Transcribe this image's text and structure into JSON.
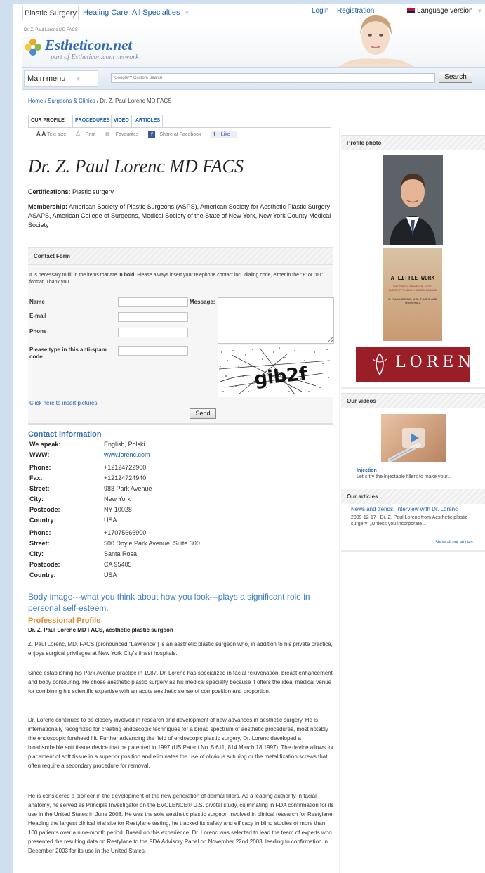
{
  "topnav": {
    "tabs": [
      "Plastic Surgery",
      "Healing Care",
      "All Specialties"
    ],
    "login": "Login",
    "registration": "Registration",
    "language": "Language version"
  },
  "header": {
    "breadcrumb_small": "Dr. Z. Paul Lorenc MD FACS",
    "logo": "Estheticon.net",
    "logo_sub": "part of Estheticon.com network"
  },
  "menubar": {
    "main_menu": "Main menu",
    "search_placeholder": "Google™ Custom Search",
    "search_button": "Search"
  },
  "breadcrumb": {
    "home": "Home",
    "sep": " / ",
    "surgeons": "Surgeons & Clinics",
    "current": "Dr. Z. Paul Lorenc MD FACS"
  },
  "tabs": [
    "OUR PROFILE",
    "PROCEDURES",
    "VIDEO",
    "ARTICLES"
  ],
  "toolbar": {
    "text_size": "Text size",
    "print": "Print",
    "favourites": "Favourites",
    "share": "Share at Facebook",
    "like": "Like"
  },
  "profile": {
    "name": "Dr. Z. Paul Lorenc MD FACS",
    "cert_label": "Certifications:",
    "cert_value": "Plastic surgery",
    "member_label": "Membership:",
    "member_value": "American Society of Plastic Surgeons (ASPS), American Society for Aesthetic Plastic Surgery ASAPS, American College of Surgeons, Medical Society of the State of New York, New York County Medical Society"
  },
  "contact_form": {
    "title": "Contact Form",
    "note_pre": "It is necessary to fill in the items that are ",
    "note_bold": "in bold",
    "note_post": ". Please always insert your telephone contact incl. dialing code, either in the \"+\" or \"00\" format. Thank you.",
    "name": "Name",
    "email": "E-mail",
    "phone": "Phone",
    "antispam": "Please type in this anti-spam code",
    "message": "Message:",
    "insert_pictures": "Click here to insert pictures.",
    "send": "Send"
  },
  "contact_info": {
    "title": "Contact information",
    "rows": [
      {
        "k": "We speak:",
        "v": "English, Polski"
      },
      {
        "k": "WWW:",
        "v": "www.lorenc.com"
      },
      {
        "k": "Phone:",
        "v": "+12124722900"
      },
      {
        "k": "Fax:",
        "v": "+12124724940"
      },
      {
        "k": "Street:",
        "v": "983 Park Avenue"
      },
      {
        "k": "City:",
        "v": "New York"
      },
      {
        "k": "Postcode:",
        "v": "NY 10028"
      },
      {
        "k": "Country:",
        "v": "USA"
      },
      {
        "k": "Phone:",
        "v": "+17075666900"
      },
      {
        "k": "Street:",
        "v": "500 Doyle Park Avenue, Suite 300"
      },
      {
        "k": "City:",
        "v": "Santa Rosa"
      },
      {
        "k": "Postcode:",
        "v": "CA 95405"
      },
      {
        "k": "Country:",
        "v": "USA"
      }
    ]
  },
  "article": {
    "quote": "Body image---what you think about how you look---plays a significant role in personal self-esteem.",
    "pp_title": "Professional Profile",
    "pp_sub": "Dr. Z. Paul Lorenc MD FACS, aesthetic plastic surgeon",
    "paragraphs": [
      "Z. Paul Lorenc, MD, FACS (pronounced \"Lawrence\") is an aesthetic plastic surgeon who, in addition to his private practice, enjoys surgical privileges at New York City's finest hospitals.",
      "Since establishing his Park Avenue practice in 1987, Dr. Lorenc has specialized in facial rejuvenation, breast enhancement and body contouring. He chose aesthetic plastic surgery as his medical specialty because it offers the ideal medical venue for combining his scientific expertise with an acute aesthetic sense of composition and proportion.",
      "Dr. Lorenc continues to be closely involved in research and development of new advances in aesthetic surgery. He is internationally recognized for creating endoscopic techniques for a broad spectrum of aesthetic procedures, most notably the endoscopic forehead lift. Further advancing the field of endoscopic plastic surgery, Dr. Lorenc developed a bioabsorbable soft tissue device that he patented in 1997 (US Patent No. 5,611, 814 March 18 1997). The device allows for placement of soft tissue in a superior position and eliminates the use of obvious suturing or the metal fixation screws that often require a secondary procedure for removal.",
      "He is considered a pioneer in the development of the new generation of dermal fillers. As a leading authority in facial anatomy, he served as Principle Investigator on the EVOLENCE® U.S. pivotal study, culminating in FDA confirmation for its use in the United States in June 2008. He was the sole aesthetic plastic surgeon involved in clinical research for Restylane. Heading the largest clinical trial site for Restylane testing, he tracked its safety and efficacy in blind studies of more than 100 patients over a nine-month period. Based on this experience, Dr. Lorenc was selected to lead the team of experts who presented the resulting data on Restylane to the FDA Advisory Panel on November 22nd 2003, leading to confirmation in December 2003 for its use in the United States."
    ]
  },
  "sidebar": {
    "photo_head": "Profile photo",
    "book_title": "A LITTLE WORK",
    "book_sub": "THE TRUTH BEHIND PLASTIC SURGERY'S MANY HIDDEN FACADE",
    "book_authors": "Z. PAUL LORENC, M.D., F.A.C.S. AND TRISH HALL",
    "banner": "LORENC",
    "videos_head": "Our videos",
    "video_title": "Injection",
    "video_desc": "Let´s try the Injectable fillers to make your...",
    "articles_head": "Our articles",
    "article_title": "News and trends: Interview with Dr. Lorenc",
    "article_date": "2009-12-17",
    "article_desc": "Dr. Z. Paul Lorenc from Aesthetic plastic surgery: „Unless you incorporate...",
    "show_all": "Show all our articles"
  },
  "colors": {
    "link": "#1a5fa8",
    "accent_orange": "#e8862a",
    "quote_blue": "#3b7dc4",
    "side_blue": "#cfdff0"
  }
}
